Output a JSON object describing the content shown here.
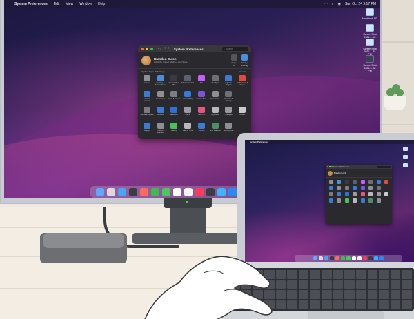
{
  "menubar": {
    "app_name": "System Preferences",
    "items": [
      "Edit",
      "View",
      "Window",
      "Help"
    ],
    "clock": "Sun Oct 24  9:17 PM"
  },
  "desktop_icons": [
    {
      "label": "Macintosh HD",
      "dark": false
    },
    {
      "label": "Screen Shot 2021-...-49 PM",
      "dark": false
    },
    {
      "label": "Screen Shot 2021-...-51 PM",
      "dark": false
    },
    {
      "label": "Screen Shot 2021-...-52 PM",
      "dark": true
    }
  ],
  "window": {
    "title": "System Preferences",
    "search_placeholder": "Search",
    "user_name": "Brandon Butch",
    "user_subtitle": "Apple ID, iCloud, Media & App Store",
    "family_label": "Apple ID",
    "family_sharing_label": "Family Sharing",
    "update_text": "Update Apple ID Settings",
    "update_details": "Details..."
  },
  "prefs": [
    {
      "label": "General",
      "color": "#8e8e93"
    },
    {
      "label": "Desktop & Screen Saver",
      "color": "#4a90d9"
    },
    {
      "label": "Dock & Menu Bar",
      "color": "#3b3b3f"
    },
    {
      "label": "Mission Control",
      "color": "#5b6170"
    },
    {
      "label": "Siri",
      "color": "#c85cff"
    },
    {
      "label": "Spotlight",
      "color": "#6e6e73"
    },
    {
      "label": "Language & Region",
      "color": "#3a7bd5"
    },
    {
      "label": "Notifications & Focus",
      "color": "#e04a3f"
    },
    {
      "label": "Internet Accounts",
      "color": "#3a7bd5"
    },
    {
      "label": "Passwords",
      "color": "#8e8e93"
    },
    {
      "label": "Users & Groups",
      "color": "#7d7d82"
    },
    {
      "label": "Accessibility",
      "color": "#2f7de1"
    },
    {
      "label": "Screen Time",
      "color": "#7a56d6"
    },
    {
      "label": "Extensions",
      "color": "#8e8e93"
    },
    {
      "label": "Security & Privacy",
      "color": "#6e7079"
    },
    {
      "label": "",
      "color": "#2a2a2e"
    },
    {
      "label": "Software Update",
      "color": "#7a7a80"
    },
    {
      "label": "Network",
      "color": "#3a7bd5"
    },
    {
      "label": "Bluetooth",
      "color": "#2f6fd8"
    },
    {
      "label": "Sound",
      "color": "#9a9aa0"
    },
    {
      "label": "Touch ID",
      "color": "#e4577f"
    },
    {
      "label": "Keyboard",
      "color": "#b8b8bd"
    },
    {
      "label": "Trackpad",
      "color": "#9a9aa0"
    },
    {
      "label": "Mouse",
      "color": "#c9c9ce"
    },
    {
      "label": "Displays",
      "color": "#3a7bd5"
    },
    {
      "label": "Printers & Scanners",
      "color": "#8e8e93"
    },
    {
      "label": "Battery",
      "color": "#4bbf5a"
    },
    {
      "label": "Date & Time",
      "color": "#b8b8bd"
    },
    {
      "label": "Sharing",
      "color": "#3a7bd5"
    },
    {
      "label": "Time Machine",
      "color": "#4b8f68"
    },
    {
      "label": "Startup Disk",
      "color": "#8e8e93"
    },
    {
      "label": "",
      "color": "#2a2a2e"
    }
  ],
  "dock_colors": [
    "#5ea8ff",
    "#d9d9de",
    "#4aa3f5",
    "#3c3c43",
    "#ff6a5a",
    "#3dbb4e",
    "#4cc85a",
    "#ffffff",
    "#f5f5f7",
    "#fa3b59",
    "#3c3c43",
    "#3bb3ff",
    "#2a8af5"
  ],
  "laptop": {
    "app_name": "System Preferences",
    "window_title": "System Preferences",
    "user_name": "Brandon Butch"
  }
}
